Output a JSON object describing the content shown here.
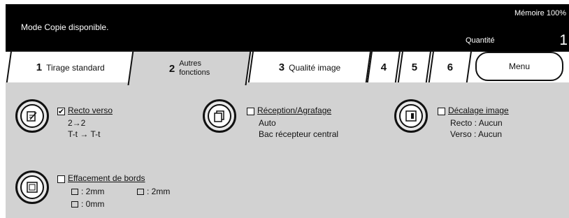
{
  "header": {
    "status": "Mode Copie disponible.",
    "memory": "Mémoire 100%",
    "quantity_label": "Quantité",
    "quantity_value": "1"
  },
  "tabs": [
    {
      "num": "1",
      "label": "Tirage standard"
    },
    {
      "num": "2",
      "label_line1": "Autres",
      "label_line2": "fonctions",
      "active": true
    },
    {
      "num": "3",
      "label": "Qualité image"
    },
    {
      "num": "4"
    },
    {
      "num": "5"
    },
    {
      "num": "6"
    },
    {
      "label": "Menu"
    }
  ],
  "features": {
    "recto_verso": {
      "title": "Recto verso",
      "checked": true,
      "line1": "2→2",
      "line2": "T-t → T-t",
      "icon": "duplex-icon"
    },
    "reception": {
      "title": "Réception/Agrafage",
      "checked": false,
      "line1": "Auto",
      "line2": "Bac récepteur central",
      "icon": "output-tray-icon"
    },
    "decalage": {
      "title": "Décalage image",
      "checked": false,
      "line1": "Recto : Aucun",
      "line2": "Verso : Aucun",
      "icon": "image-shift-icon"
    },
    "effacement": {
      "title": "Effacement de bords",
      "checked": false,
      "line1": ": 2mm",
      "line1b": ": 2mm",
      "line2": ": 0mm",
      "icon": "edge-erase-icon"
    }
  }
}
